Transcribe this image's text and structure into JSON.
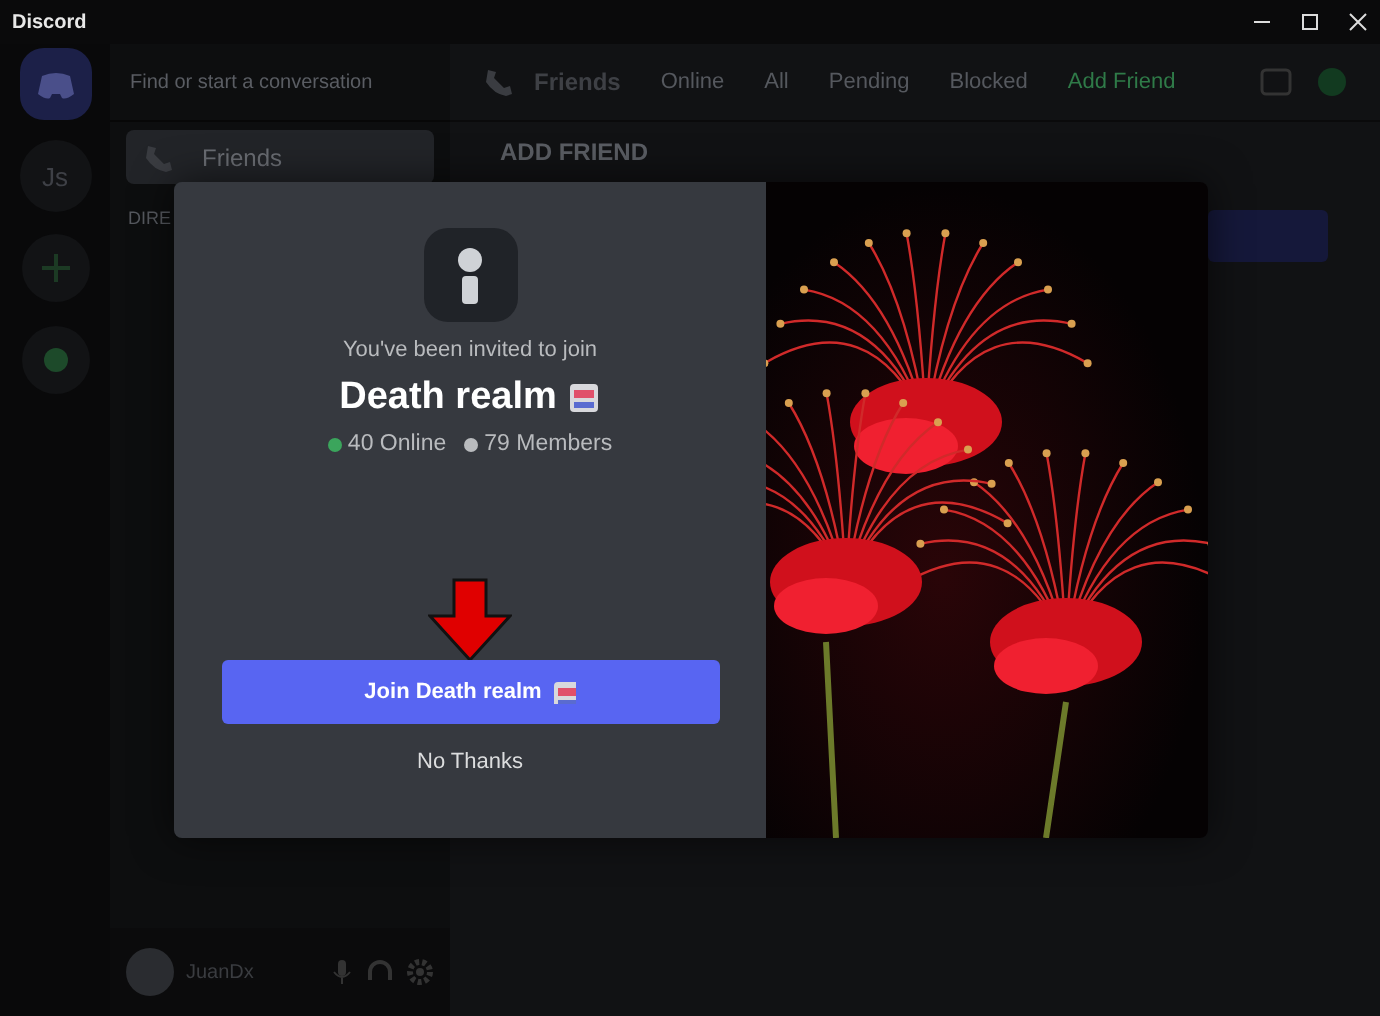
{
  "window": {
    "title": "Discord"
  },
  "server_rail": {
    "items": [
      {
        "label": "Js"
      }
    ]
  },
  "dm_sidebar": {
    "search": {
      "placeholder": "Find or start a conversation"
    },
    "items": [
      {
        "label": "Friends",
        "selected": true
      }
    ],
    "section_heading": "DIRE"
  },
  "user_panel": {
    "username": "JuanDx"
  },
  "header": {
    "title": "Friends",
    "tabs": [
      {
        "label": "Online",
        "selected": false
      },
      {
        "label": "All",
        "selected": false
      },
      {
        "label": "Pending",
        "selected": false
      },
      {
        "label": "Blocked",
        "selected": false
      },
      {
        "label": "Add Friend",
        "selected": true
      }
    ]
  },
  "add_friend": {
    "heading": "ADD FRIEND"
  },
  "invite_modal": {
    "subtitle": "You've been invited to join",
    "server_name": "Death realm",
    "stats": [
      {
        "label": "40 Online",
        "color": "#3ba55c"
      },
      {
        "label": "79 Members",
        "color": "#b9bbbe"
      }
    ],
    "join_button": "Join Death realm",
    "dismiss_link": "No Thanks"
  }
}
